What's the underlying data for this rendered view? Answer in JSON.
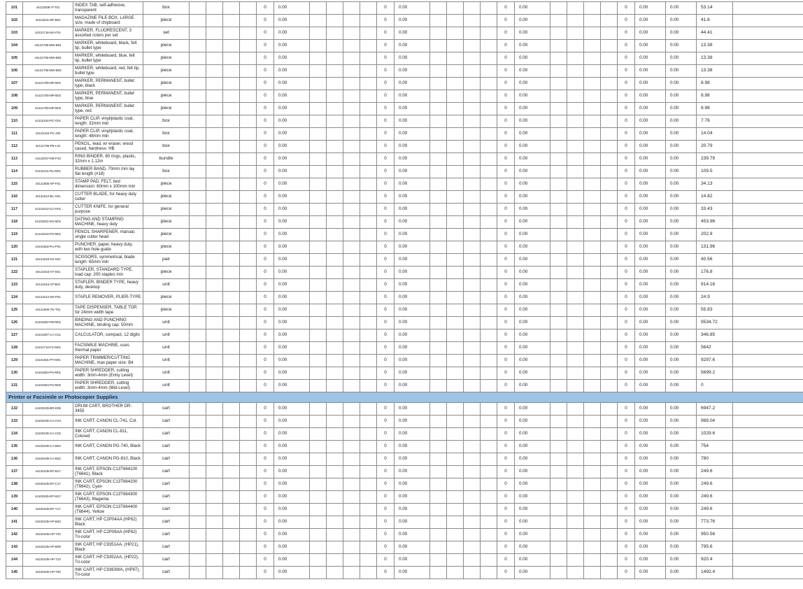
{
  "section_heading": "Printer or Facsimile or Photocopier Supplies",
  "columns": {
    "q1_qty": "0",
    "q1_amt": "0.00",
    "q2_qty": "0",
    "q2_amt": "0.00",
    "q3_qty": "0",
    "q3_amt": "0.00",
    "q4_qty": "0",
    "q4_amt": "0.00",
    "q4_amt2": "0.00",
    "total": "0.00"
  },
  "rows_a": [
    {
      "no": "101",
      "code": "44122008-IT-T01",
      "desc": "INDEX TAB, self-adhesive, transparent",
      "unit": "box",
      "price": "53.14"
    },
    {
      "no": "102",
      "code": "44111515-MF-B02",
      "desc": "MAGAZINE FILE BOX, LARGE size, made of chipboard",
      "unit": "piece",
      "price": "41.6"
    },
    {
      "no": "103",
      "code": "44121716-MA-F01",
      "desc": "MARKER, FLUORESCENT, 3 assorted colors per set",
      "unit": "set",
      "price": "44.41"
    },
    {
      "no": "104",
      "code": "44121708-MW-B01",
      "desc": "MARKER, whiteboard, black, felt tip, bullet type",
      "unit": "piece",
      "price": "13.38"
    },
    {
      "no": "105",
      "code": "44121708-MW-B02",
      "desc": "MARKER, whiteboard, blue, felt tip, bullet type",
      "unit": "piece",
      "price": "13.38"
    },
    {
      "no": "106",
      "code": "44121708-MW-B03",
      "desc": "MARKER, whiteboard, red, felt tip, bullet type",
      "unit": "piece",
      "price": "13.38"
    },
    {
      "no": "107",
      "code": "44121708-MP-B01",
      "desc": "MARKER, PERMANENT, bullet type, black",
      "unit": "piece",
      "price": "8.98"
    },
    {
      "no": "108",
      "code": "44121708-MP-B02",
      "desc": "MARKER, PERMANENT, bullet type, blue",
      "unit": "piece",
      "price": "8.98"
    },
    {
      "no": "109",
      "code": "44121708-MP-B03",
      "desc": "MARKER, PERMANENT, bullet type, red",
      "unit": "piece",
      "price": "8.98"
    },
    {
      "no": "110",
      "code": "44122104-PC-G01",
      "desc": "PAPER CLIP, vinyl/plastic coat, length: 32mm min",
      "unit": "box",
      "price": "7.76"
    },
    {
      "no": "111",
      "code": "44122104-PC-J02",
      "desc": "PAPER CLIP, vinyl/plastic coat, length: 48mm min",
      "unit": "box",
      "price": "14.04"
    },
    {
      "no": "112",
      "code": "44121706-PE-L01",
      "desc": "PENCIL, lead, w/ eraser, wood cased, hardness: HB",
      "unit": "box",
      "price": "20.79"
    },
    {
      "no": "113",
      "code": "44122037-RB-P10",
      "desc": "RING BINDER, 80 rings, plastic, 32mm x 1.12m",
      "unit": "bundle",
      "price": "239.79"
    },
    {
      "no": "114",
      "code": "44122101-RU-B01",
      "desc": "RUBBER BAND, 70mm min lay flat length (#18)",
      "unit": "box",
      "price": "109.5"
    },
    {
      "no": "115",
      "code": "44121905-SP-F01",
      "desc": "STAMP PAD, FELT, bed dimension: 60mm x 100mm min",
      "unit": "piece",
      "price": "34.13"
    },
    {
      "no": "116",
      "code": "44121612-BL-H01",
      "desc": "CUTTER BLADE, for heavy duty cutter",
      "unit": "piece",
      "price": "14.82"
    },
    {
      "no": "117",
      "code": "44121612-CU-H01",
      "desc": "CUTTER KNIFE, for general purpose",
      "unit": "piece",
      "price": "33.43"
    },
    {
      "no": "118",
      "code": "44103202-DS-M01",
      "desc": "DATING AND STAMPING MACHINE, heavy duty",
      "unit": "piece",
      "price": "453.96"
    },
    {
      "no": "119",
      "code": "44121619-PS-M01",
      "desc": "PENCIL SHARPENER, manual, single cutter head",
      "unit": "piece",
      "price": "202.8"
    },
    {
      "no": "120",
      "code": "44101602-PU-P01",
      "desc": "PUNCHER, paper, heavy duty, with two hole guide",
      "unit": "piece",
      "price": "131.96"
    },
    {
      "no": "121",
      "code": "44121618-SS-S01",
      "desc": "SCISSORS, symmetrical, blade length: 65mm min",
      "unit": "pair",
      "price": "40.56"
    },
    {
      "no": "122",
      "code": "44121615-ST-S01",
      "desc": "STAPLER, STANDARD TYPE, load cap: 200 staples min",
      "unit": "piece",
      "price": "176.8"
    },
    {
      "no": "123",
      "code": "44121615-ST-B01",
      "desc": "STAPLER, BINDER TYPE, heavy duty, desktop",
      "unit": "unit",
      "price": "914.16"
    },
    {
      "no": "124",
      "code": "44121613-SR-P01",
      "desc": "STAPLE REMOVER, PLIER-TYPE",
      "unit": "piece",
      "price": "24.9"
    },
    {
      "no": "125",
      "code": "44121605-TD-T01",
      "desc": "TAPE DISPENSER, TABLE TOP, for 24mm width tape",
      "unit": "piece",
      "price": "55.83"
    },
    {
      "no": "126",
      "code": "44101602-PB-M01",
      "desc": "BINDING AND PUNCHING MACHINE, binding cap: 50mm",
      "unit": "unit",
      "price": "9534.72"
    },
    {
      "no": "127",
      "code": "44101807-CA-C01",
      "desc": "CALCULATOR, compact, 12 digits",
      "unit": "unit",
      "price": "346.85"
    },
    {
      "no": "128",
      "code": "44101714-FX-M01",
      "desc": "FACSIMILE MACHINE, uses thermal paper",
      "unit": "unit",
      "price": "5642"
    },
    {
      "no": "129",
      "code": "44101601-PT-M01",
      "desc": "PAPER TRIMMER/CUTTING MACHINE, max paper size: B4",
      "unit": "unit",
      "price": "9297.6"
    },
    {
      "no": "130",
      "code": "44101603-PS-M01",
      "desc": "PAPER SHREDDER, cutting width: 3mm-4mm (Entry Level)",
      "unit": "unit",
      "price": "5699.2"
    },
    {
      "no": "131",
      "code": "44101603-PS-M02",
      "desc": "PAPER SHREDDER, cutting width: 3mm-4mm (Mid-Level)",
      "unit": "unit",
      "price": "0"
    }
  ],
  "rows_b": [
    {
      "no": "132",
      "code": "44103109-BR-D05",
      "desc": "DRUM CART, BROTHER DR-3455",
      "unit": "cart",
      "price": "6947.2"
    },
    {
      "no": "133",
      "code": "44103105-CA-C04",
      "desc": "INK CART, CANON CL-741, Col.",
      "unit": "cart",
      "price": "989.04"
    },
    {
      "no": "134",
      "code": "44103105-CA-C02",
      "desc": "INK CART, CANON CL-811, Colored",
      "unit": "cart",
      "price": "1029.6"
    },
    {
      "no": "135",
      "code": "44103105-CA-B04",
      "desc": "INK CART, CANON PG-740, Black",
      "unit": "cart",
      "price": "754"
    },
    {
      "no": "136",
      "code": "44103105-CA-B02",
      "desc": "INK CART, CANON PG-810, Black",
      "unit": "cart",
      "price": "780"
    },
    {
      "no": "137",
      "code": "44103105-EP-B17",
      "desc": "INK CART, EPSON C13T664100 (T6641), Black",
      "unit": "cart",
      "price": "249.6"
    },
    {
      "no": "138",
      "code": "44103105-EP-C17",
      "desc": "INK CART, EPSON C13T664200 (T6642), Cyan",
      "unit": "cart",
      "price": "249.6"
    },
    {
      "no": "139",
      "code": "44103105-EP-M17",
      "desc": "INK CART, EPSON C13T664300 (T6643), Magenta",
      "unit": "cart",
      "price": "249.6"
    },
    {
      "no": "140",
      "code": "44103105-EP-Y17",
      "desc": "INK CART, EPSON C13T664400 (T6644), Yellow",
      "unit": "cart",
      "price": "249.6"
    },
    {
      "no": "141",
      "code": "44103105-HP-B40",
      "desc": "INK CART, HP C2P04AA (HP62) Black",
      "unit": "cart",
      "price": "773.76"
    },
    {
      "no": "142",
      "code": "44103105-HP-T40",
      "desc": "INK CART, HP C2P06AA (HP62) Tri-color",
      "unit": "cart",
      "price": "950.56"
    },
    {
      "no": "143",
      "code": "44103105-HP-B09",
      "desc": "INK CART, HP C9351AA, (HP21), Black",
      "unit": "cart",
      "price": "795.6"
    },
    {
      "no": "144",
      "code": "44103105-HP-T10",
      "desc": "INK CART, HP C9352AA, (HP22), Tri-color",
      "unit": "cart",
      "price": "920.4"
    },
    {
      "no": "145",
      "code": "44103105-HP-T30",
      "desc": "INK CART, HP C9363WA, (HP97), Tri-color",
      "unit": "cart",
      "price": "1492.4"
    }
  ]
}
